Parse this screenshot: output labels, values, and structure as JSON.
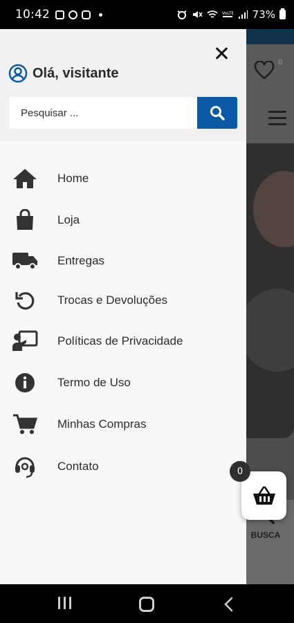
{
  "status_bar": {
    "time": "10:42",
    "battery": "73%",
    "icons": [
      "image-icon",
      "b-icon",
      "instagram-icon",
      "dot-icon",
      "alarm-icon",
      "mute-icon",
      "wifi-icon",
      "volte-icon",
      "signal-icon",
      "battery-icon"
    ]
  },
  "drawer": {
    "greeting": "Olá, visitante",
    "search": {
      "placeholder": "Pesquisar ...",
      "value": ""
    },
    "menu": [
      {
        "label": "Home",
        "icon": "home-icon"
      },
      {
        "label": "Loja",
        "icon": "shopping-bag-icon"
      },
      {
        "label": "Entregas",
        "icon": "truck-icon"
      },
      {
        "label": "Trocas e Devoluções",
        "icon": "undo-icon"
      },
      {
        "label": "Políticas de Privacidade",
        "icon": "presentation-icon"
      },
      {
        "label": "Termo de Uso",
        "icon": "info-icon"
      },
      {
        "label": "Minhas Compras",
        "icon": "cart-icon"
      },
      {
        "label": "Contato",
        "icon": "headset-icon"
      }
    ]
  },
  "background_app": {
    "wishlist_count": "0",
    "search_tab_label": "BUSCA"
  },
  "cart": {
    "count": "0"
  },
  "colors": {
    "accent": "#0b5aa8",
    "drawer_bg": "#f8f8f8",
    "text": "#2b2b2b",
    "icon": "#333333"
  }
}
